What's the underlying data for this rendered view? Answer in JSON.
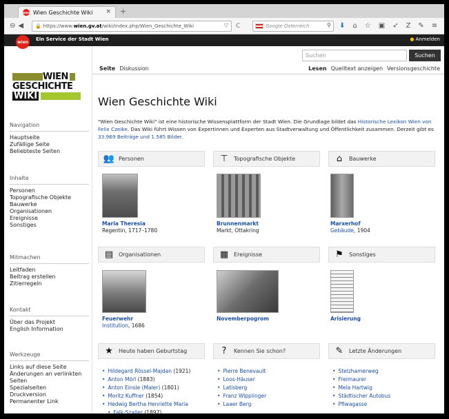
{
  "browser": {
    "tab_title": "Wien Geschichte Wiki",
    "url_prefix": "https://www.",
    "url_domain": "wien.gv.at",
    "url_path": "/wiki/index.php/Wien_Geschichte_Wiki",
    "search_placeholder": "Google Österreich"
  },
  "service_bar": {
    "badge": "wien",
    "text": "Ein Service der Stadt Wien",
    "login": "Anmelden"
  },
  "logo": {
    "line1": "WIEN",
    "line2": "GESCHICHTE",
    "line3": "WIKI"
  },
  "sidebar": {
    "navigation": {
      "head": "Navigation",
      "items": [
        "Hauptseite",
        "Zufällige Seite",
        "Beliebteste Seiten"
      ]
    },
    "inhalte": {
      "head": "Inhalte",
      "items": [
        "Personen",
        "Topografische Objekte",
        "Bauwerke",
        "Organisationen",
        "Ereignisse",
        "Sonstiges"
      ]
    },
    "mitmachen": {
      "head": "Mitmachen",
      "items": [
        "Leitfaden",
        "Beitrag erstellen",
        "Zitierregeln"
      ]
    },
    "kontakt": {
      "head": "Kontakt",
      "items": [
        "Über das Projekt",
        "English Information"
      ]
    },
    "werkzeuge": {
      "head": "Werkzeuge",
      "items": [
        "Links auf diese Seite",
        "Änderungen an verlinkten Seiten",
        "Spezialseiten",
        "Druckversion",
        "Permanenter Link"
      ]
    }
  },
  "topnav": {
    "search_placeholder": "Suchen",
    "search_button": "Suchen",
    "tab_page": "Seite",
    "tab_discussion": "Diskussion",
    "tab_read": "Lesen",
    "tab_source": "Quelltext anzeigen",
    "tab_history": "Versionsgeschichte"
  },
  "main": {
    "title": "Wien Geschichte Wiki",
    "intro_1": "\"Wien Geschichte Wiki\" ist eine historische Wissensplattform der Stadt Wien. Die Grundlage bildet das ",
    "intro_link1": "Historische Lexikon Wien von Felix Czeike",
    "intro_2": ". Das Wiki führt Wissen von Expertinnen und Experten aus Stadtverwaltung und Öffentlichkeit zusammen. Derzeit gibt es ",
    "intro_link2": "33.969 Beiträge und 1.585 Bilder",
    "intro_3": "."
  },
  "boxes": [
    {
      "head": "Personen",
      "icon": "people-icon",
      "name": "Maria Theresia",
      "sub": "Regentin, 1717–1780"
    },
    {
      "head": "Topografische Objekte",
      "icon": "signpost-icon",
      "name": "Brunnenmarkt",
      "sub_link": "Markt, Ottakring"
    },
    {
      "head": "Bauwerke",
      "icon": "house-icon",
      "name": "Marxerhof",
      "sub_link": "Gebäude",
      "sub_rest": ", 1904"
    },
    {
      "head": "Organisationen",
      "icon": "id-card-icon",
      "name": "Feuerwehr",
      "sub_link": "Institution",
      "sub_rest": ", 1686"
    },
    {
      "head": "Ereignisse",
      "icon": "calendar-icon",
      "name": "Novemberpogrom"
    },
    {
      "head": "Sonstiges",
      "icon": "flag-icon",
      "name": "Arisierung"
    }
  ],
  "bottom": {
    "birthday_head": "Heute haben Geburtstag",
    "didyouknow_head": "Kennen Sie schon?",
    "changes_head": "Letzte Änderungen",
    "birthdays": [
      {
        "name": "Hildegard Rössel-Majdan",
        "year": " (1921)"
      },
      {
        "name": "Anton Mörl",
        "year": " (1883)"
      },
      {
        "name": "Anton Einsle (Maler)",
        "year": " (1801)"
      },
      {
        "name": "Moritz Kuffner",
        "year": " (1854)"
      },
      {
        "name": "Hedwig Bertha Henriette Maria",
        "year": ""
      },
      {
        "name": "Falk-Szaller",
        "year": " (1897)"
      }
    ],
    "didyouknow": [
      "Pierre Benevault",
      "Loos-Häuser",
      "Latisberg",
      "Franz Wipplinger",
      "Laaer Berg"
    ],
    "changes": [
      "Stelzhamerweg",
      "Freimaurer",
      "Mela Hartwig",
      "Städtischer Autobus",
      "Pfiwagasse"
    ]
  }
}
